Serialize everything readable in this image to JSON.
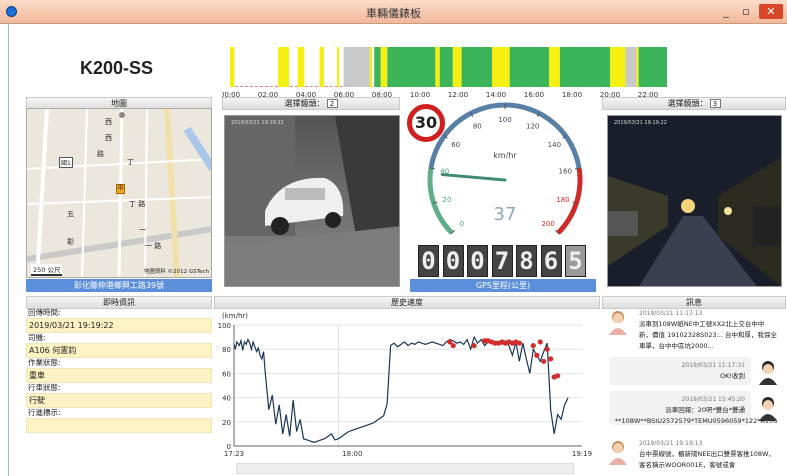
{
  "window": {
    "title": "車輛儀錶板",
    "min_label": "_",
    "max_label": "▫",
    "close_label": "✕"
  },
  "vehicle": {
    "id": "K200-SS"
  },
  "timeline": {
    "ticks": [
      "00:00",
      "02:00",
      "04:00",
      "06:00",
      "08:00",
      "10:00",
      "12:00",
      "14:00",
      "16:00",
      "18:00",
      "20:00",
      "22:00"
    ],
    "segments": [
      {
        "s": 0.0,
        "e": 0.01,
        "c": "yellow"
      },
      {
        "s": 0.11,
        "e": 0.135,
        "c": "yellow"
      },
      {
        "s": 0.155,
        "e": 0.17,
        "c": "yellow"
      },
      {
        "s": 0.205,
        "e": 0.215,
        "c": "yellow"
      },
      {
        "s": 0.245,
        "e": 0.25,
        "c": "yellow"
      },
      {
        "s": 0.26,
        "e": 0.32,
        "c": "gray"
      },
      {
        "s": 0.32,
        "e": 0.325,
        "c": "yellow"
      },
      {
        "s": 0.33,
        "e": 0.345,
        "c": "green"
      },
      {
        "s": 0.345,
        "e": 0.36,
        "c": "yellow"
      },
      {
        "s": 0.36,
        "e": 0.47,
        "c": "green"
      },
      {
        "s": 0.47,
        "e": 0.48,
        "c": "yellow"
      },
      {
        "s": 0.48,
        "e": 0.51,
        "c": "green"
      },
      {
        "s": 0.51,
        "e": 0.53,
        "c": "yellow"
      },
      {
        "s": 0.53,
        "e": 0.6,
        "c": "green"
      },
      {
        "s": 0.6,
        "e": 0.64,
        "c": "yellow"
      },
      {
        "s": 0.64,
        "e": 0.73,
        "c": "green"
      },
      {
        "s": 0.73,
        "e": 0.755,
        "c": "yellow"
      },
      {
        "s": 0.755,
        "e": 0.87,
        "c": "green"
      },
      {
        "s": 0.87,
        "e": 0.905,
        "c": "yellow"
      },
      {
        "s": 0.905,
        "e": 0.93,
        "c": "gray"
      },
      {
        "s": 0.93,
        "e": 0.935,
        "c": "yellow"
      },
      {
        "s": 0.935,
        "e": 1.0,
        "c": "green"
      }
    ],
    "colors": {
      "yellow": "#f5ef12",
      "green": "#3cb55a",
      "gray": "#c9c9c9"
    }
  },
  "map": {
    "header": "地圖",
    "address": "彰化縣伸港鄉興工路39號",
    "scale": "250 公尺",
    "copyright": "地圖資料 ©2012 GSTech",
    "labels": [
      "西",
      "西",
      "路",
      "丁",
      "丁 路",
      "五",
      "彰",
      "一",
      "一 路"
    ],
    "pin_label": "中",
    "road_badge": "國1"
  },
  "camera_left": {
    "select_label": "選擇鏡頭：",
    "select_value": "2",
    "timestamp": "2019/03/21 19:19:22"
  },
  "camera_right": {
    "select_label": "選擇鏡頭：",
    "select_value": "3",
    "timestamp": "2019/03/21 19:19:22"
  },
  "speed": {
    "limit": "30",
    "unit": "km/hr",
    "value": "37",
    "needle_value": 37,
    "ticks": [
      "0",
      "20",
      "40",
      "60",
      "80",
      "100",
      "120",
      "140",
      "160",
      "180",
      "200"
    ],
    "odometer": [
      "0",
      "0",
      "0",
      "7",
      "8",
      "6",
      "5"
    ],
    "gps_label": "GPS里程(公里)"
  },
  "realtime": {
    "header": "即時資訊",
    "fields": [
      {
        "label": "回傳時間:",
        "value": "2019/03/21 19:19:22"
      },
      {
        "label": "司機:",
        "value": "A106 何憲鈞"
      },
      {
        "label": "作業狀態:",
        "value": "重車"
      },
      {
        "label": "行車狀態:",
        "value": "行駛"
      },
      {
        "label": "行進標示:",
        "value": ""
      }
    ]
  },
  "history": {
    "header": "歷史速度"
  },
  "messages": {
    "header": "訊息",
    "items": [
      {
        "time": "2019/03/21 11:17:13",
        "text": "派車到108W紙NE中工號XX2北上交台中中新，價值 19102328S023... 台中和厚，我保全車單，台中中區坑2000...",
        "side": "left"
      },
      {
        "time": "2019/03/21 11:17:31",
        "text": "OK!收到",
        "side": "right"
      },
      {
        "time": "2019/03/21 15:45:20",
        "text": "派車回報：20呎*雙台*雙通**108W**BSIU2572579*TEMU0596059*122*A106",
        "side": "right"
      },
      {
        "time": "2019/03/21 19:19:13",
        "text": "台中票線號，櫃新陽NEE出口雙票客推108W，客名稱示WOOR001E，客號或會",
        "side": "left"
      }
    ]
  },
  "chart_data": {
    "type": "line",
    "title": "",
    "xlabel": "",
    "ylabel": "(km/hr)",
    "ylim": [
      0,
      100
    ],
    "yticks": [
      0,
      20,
      40,
      60,
      80,
      100
    ],
    "xtick_labels": [
      "17:23",
      "18:00",
      "19:19"
    ],
    "x": [
      0,
      0.4,
      0.8,
      1.5,
      2,
      2.5,
      3,
      3.5,
      4,
      4.5,
      5,
      5.5,
      6,
      6.5,
      7,
      7.5,
      8,
      8.5,
      9,
      10,
      11,
      12,
      13,
      14,
      15,
      16,
      17,
      18,
      19,
      20,
      21,
      22,
      23,
      24,
      25,
      26,
      27,
      28,
      29,
      30,
      31,
      32,
      33,
      34,
      35,
      36,
      37,
      38,
      39,
      40,
      41,
      42,
      43,
      44,
      45,
      46,
      47,
      48,
      49,
      50,
      51,
      52,
      53,
      54,
      55,
      56,
      57,
      58,
      59,
      60,
      61,
      62,
      63,
      64,
      65,
      66,
      67,
      68,
      69,
      70,
      71,
      72,
      73,
      74,
      75,
      76,
      77,
      78,
      79,
      80,
      81,
      82,
      83,
      84,
      85,
      86,
      87,
      88,
      89,
      90,
      91,
      92,
      93,
      94,
      95,
      96,
      97,
      98,
      99,
      100
    ],
    "values": [
      84,
      80,
      86,
      83,
      87,
      79,
      86,
      84,
      88,
      85,
      80,
      86,
      82,
      78,
      81,
      75,
      72,
      78,
      60,
      30,
      42,
      18,
      34,
      10,
      26,
      8,
      38,
      12,
      22,
      6,
      5,
      4,
      3,
      4,
      5,
      6,
      8,
      10,
      5,
      6,
      8,
      10,
      12,
      13,
      14,
      15,
      16,
      17,
      18,
      19,
      21,
      23,
      25,
      35,
      83,
      85,
      82,
      84,
      86,
      83,
      85,
      84,
      86,
      85,
      84,
      85,
      86,
      85,
      84,
      83,
      86,
      88,
      87,
      85,
      86,
      84,
      88,
      80,
      90,
      85,
      88,
      83,
      86,
      87,
      85,
      86,
      84,
      87,
      83,
      75,
      86,
      70,
      85,
      72,
      60,
      80,
      75,
      70,
      78,
      85,
      30,
      10,
      26,
      22,
      34,
      40
    ],
    "markers": {
      "x": [
        62,
        63,
        69,
        72,
        73,
        74,
        75,
        76,
        77,
        78,
        79,
        80,
        81,
        82,
        86,
        87,
        88,
        89,
        90,
        91,
        92,
        93
      ],
      "values": [
        86,
        83,
        83,
        87,
        87,
        86,
        85,
        85,
        86,
        85,
        86,
        85,
        86,
        85,
        83,
        75,
        86,
        70,
        80,
        72,
        57,
        58
      ]
    },
    "x_range": [
      0,
      100
    ],
    "grid": true,
    "line_color": "#1a3655",
    "marker_color": "#d12d2d"
  }
}
